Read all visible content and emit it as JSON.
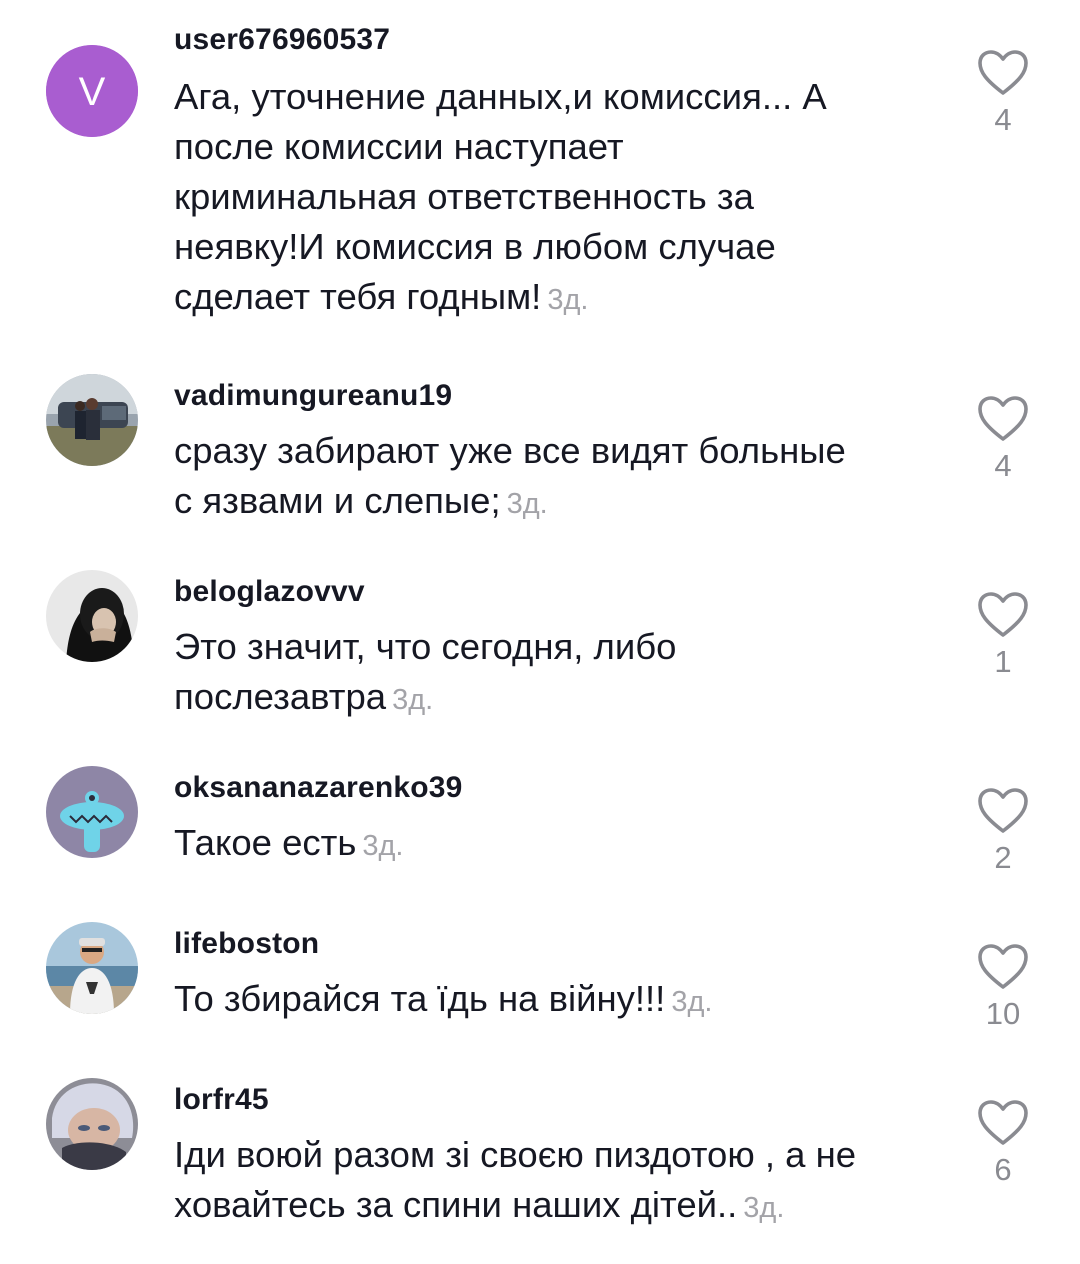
{
  "comments": [
    {
      "username": "user676960537",
      "avatar_letter": "V",
      "text": "Ага, уточнение данных,и комиссия... А после комиссии наступает криминальная ответственность за неявку!И комиссия в любом случае сделает тебя годным!",
      "text_lines": [
        "Ага, уточнение данных,и комиссия... А",
        "после комиссии наступает",
        "криминальная ответственность за",
        "неявку!И комиссия в любом случае",
        "сделает тебя годным!"
      ],
      "time": "3д.",
      "likes": "4"
    },
    {
      "username": "vadimungureanu19",
      "text_lines": [
        "сразу забирают уже все видят больные",
        "с язвами и слепые;"
      ],
      "time": "3д.",
      "likes": "4"
    },
    {
      "username": "beloglazovvv",
      "text_lines": [
        "Это значит, что сегодня, либо",
        "послезавтра"
      ],
      "time": "3д.",
      "likes": "1"
    },
    {
      "username": "oksananazarenko39",
      "text_lines": [
        "Такое есть"
      ],
      "time": "3д.",
      "likes": "2"
    },
    {
      "username": "lifeboston",
      "text_lines": [
        "То збирайся та їдь на війну!!!"
      ],
      "time": "3д.",
      "likes": "10"
    },
    {
      "username": "lorfr45",
      "text_lines": [
        "Іди воюй разом зі своєю пиздотою , а не",
        "ховайтесь за спини наших дітей.."
      ],
      "time": "3д.",
      "likes": "6"
    }
  ],
  "colors": {
    "text": "#161823",
    "time": "#a3a3a8",
    "like_count": "#8a8b91",
    "heart": "#8a8b91",
    "letter_avatar_bg": "#a95dd0"
  },
  "icons": {
    "like": "heart-outline-icon"
  }
}
